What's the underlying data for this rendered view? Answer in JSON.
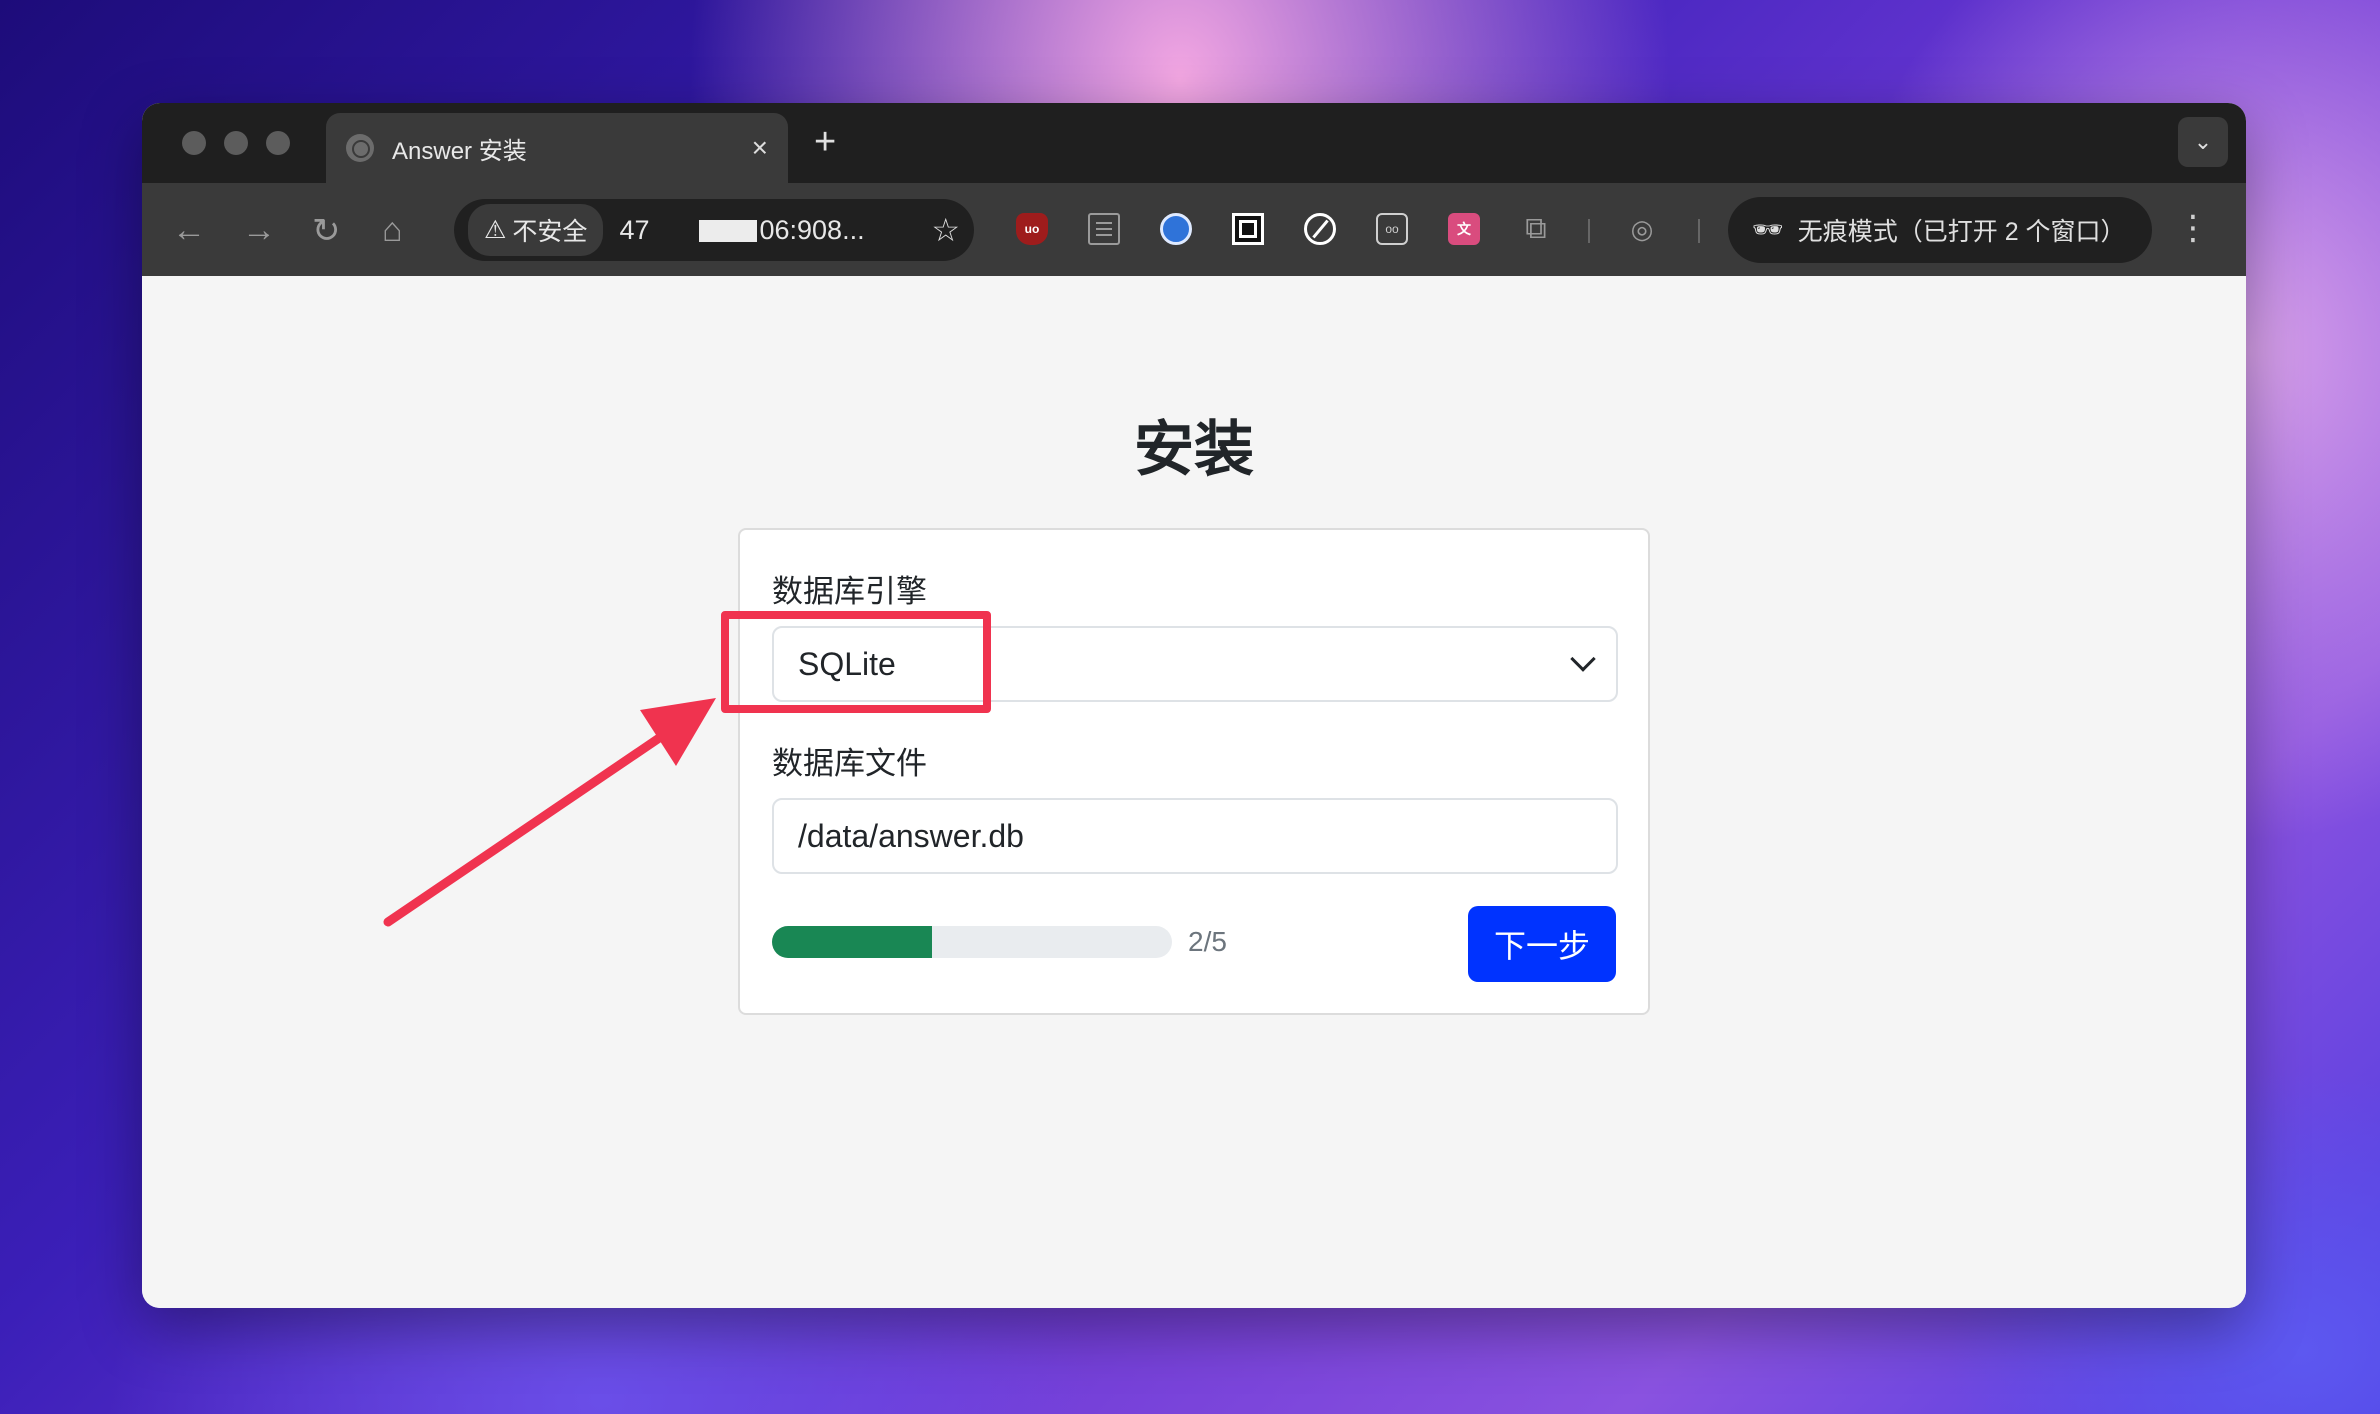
{
  "browser": {
    "tab_title": "Answer 安装",
    "tab_close": "×",
    "new_tab": "+",
    "security_chip": "不安全",
    "url_prefix": "47",
    "url_suffix": "06:908...",
    "incognito_label": "无痕模式（已打开 2 个窗口）"
  },
  "page": {
    "title": "安装",
    "db_engine_label": "数据库引擎",
    "db_engine_value": "SQLite",
    "db_file_label": "数据库文件",
    "db_file_value": "/data/answer.db",
    "progress_text": "2/5",
    "progress_fraction": 0.4,
    "next_button": "下一步"
  },
  "colors": {
    "accent": "#0033ff",
    "progress": "#198754",
    "annotation": "#f0334f"
  }
}
